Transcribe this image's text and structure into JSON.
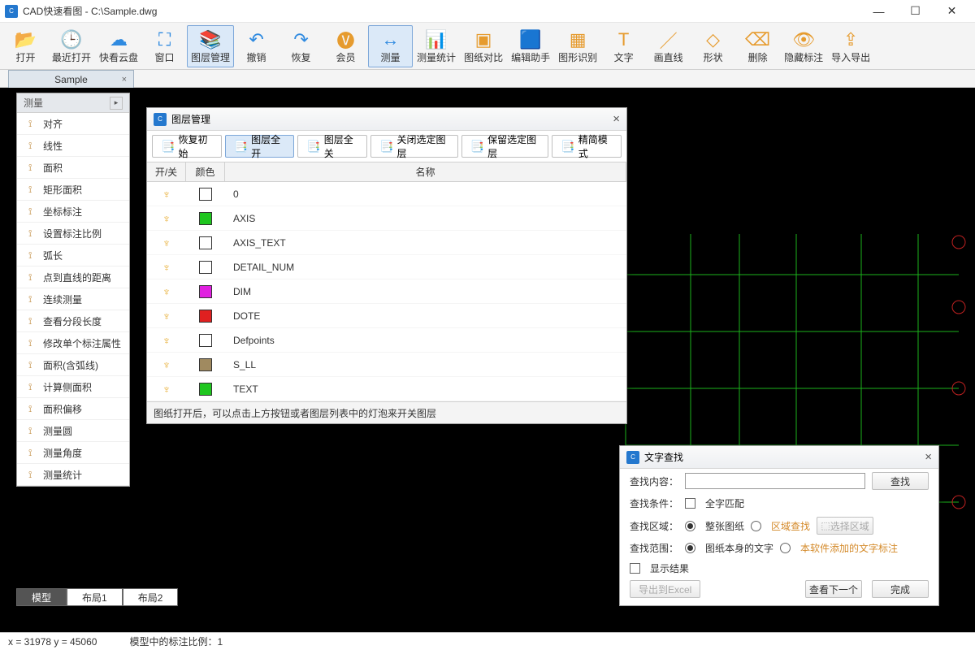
{
  "window": {
    "title": "CAD快速看图 - C:\\Sample.dwg"
  },
  "toolbar": [
    {
      "label": "打开",
      "icon": "📂",
      "cls": ""
    },
    {
      "label": "最近打开",
      "icon": "🕒",
      "cls": ""
    },
    {
      "label": "快看云盘",
      "icon": "☁",
      "cls": ""
    },
    {
      "label": "窗口",
      "icon": "⛶",
      "cls": ""
    },
    {
      "label": "图层管理",
      "icon": "📚",
      "cls": "active"
    },
    {
      "label": "撤销",
      "icon": "↶",
      "cls": ""
    },
    {
      "label": "恢复",
      "icon": "↷",
      "cls": ""
    },
    {
      "label": "会员",
      "icon": "🅥",
      "cls": "",
      "ic": "orange"
    },
    {
      "label": "测量",
      "icon": "↔",
      "cls": "active"
    },
    {
      "label": "测量统计",
      "icon": "📊",
      "cls": "",
      "ic": "orange"
    },
    {
      "label": "图纸对比",
      "icon": "▣",
      "cls": "",
      "ic": "orange"
    },
    {
      "label": "编辑助手",
      "icon": "🟦",
      "cls": ""
    },
    {
      "label": "图形识别",
      "icon": "▦",
      "cls": "",
      "ic": "orange"
    },
    {
      "label": "文字",
      "icon": "T",
      "cls": "",
      "ic": "orange"
    },
    {
      "label": "画直线",
      "icon": "／",
      "cls": "",
      "ic": "orange"
    },
    {
      "label": "形状",
      "icon": "◇",
      "cls": "",
      "ic": "orange"
    },
    {
      "label": "删除",
      "icon": "⌫",
      "cls": "",
      "ic": "orange"
    },
    {
      "label": "隐藏标注",
      "icon": "👁",
      "cls": "",
      "ic": "orange"
    },
    {
      "label": "导入导出",
      "icon": "⇪",
      "cls": "",
      "ic": "orange"
    }
  ],
  "doc_tab": {
    "name": "Sample"
  },
  "sidepanel": {
    "title": "测量",
    "items": [
      "对齐",
      "线性",
      "面积",
      "矩形面积",
      "坐标标注",
      "设置标注比例",
      "弧长",
      "点到直线的距离",
      "连续测量",
      "查看分段长度",
      "修改单个标注属性",
      "面积(含弧线)",
      "计算侧面积",
      "面积偏移",
      "测量圆",
      "测量角度",
      "测量统计"
    ]
  },
  "layer_dlg": {
    "title": "图层管理",
    "buttons": [
      "恢复初始",
      "图层全开",
      "图层全关",
      "关闭选定图层",
      "保留选定图层",
      "精简模式"
    ],
    "head_on": "开/关",
    "head_color": "颜色",
    "head_name": "名称",
    "rows": [
      {
        "name": "0",
        "color": "#ffffff"
      },
      {
        "name": "AXIS",
        "color": "#1fc61f"
      },
      {
        "name": "AXIS_TEXT",
        "color": "#ffffff"
      },
      {
        "name": "DETAIL_NUM",
        "color": "#ffffff"
      },
      {
        "name": "DIM",
        "color": "#e020e0"
      },
      {
        "name": "DOTE",
        "color": "#e02020"
      },
      {
        "name": "Defpoints",
        "color": "#ffffff"
      },
      {
        "name": "S_LL",
        "color": "#a08a60"
      },
      {
        "name": "TEXT",
        "color": "#1fc61f"
      }
    ],
    "footer": "图纸打开后，可以点击上方按钮或者图层列表中的灯泡来开关图层"
  },
  "find_dlg": {
    "title": "文字查找",
    "label_content": "查找内容：",
    "label_cond": "查找条件：",
    "cond_whole": "全字匹配",
    "label_area": "查找区域：",
    "area_whole": "整张图纸",
    "area_region": "区域查找",
    "btn_select_region": "选择区域",
    "label_range": "查找范围：",
    "range_drawing": "图纸本身的文字",
    "range_annot": "本软件添加的文字标注",
    "show_results": "显示结果",
    "btn_search": "查找",
    "btn_export": "导出到Excel",
    "btn_next": "查看下一个",
    "btn_done": "完成"
  },
  "layout_tabs": [
    "模型",
    "布局1",
    "布局2"
  ],
  "status": {
    "coords": "x = 31978  y = 45060",
    "scale": "模型中的标注比例：1"
  }
}
